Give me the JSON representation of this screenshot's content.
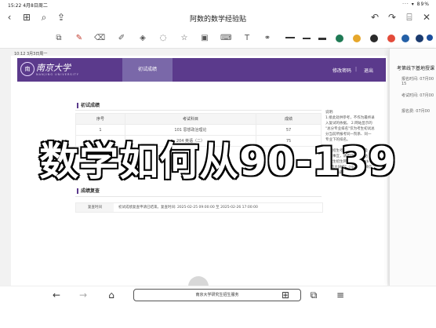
{
  "status_bar": {
    "time_date": "15:22 4月8日周二",
    "indicators": "··· ▾ 89%"
  },
  "top_toolbar": {
    "title": "阿数的数学经验贴",
    "icons": [
      "back-chevron-icon",
      "grid-icon",
      "search-icon",
      "share-icon",
      "undo-icon",
      "redo-icon",
      "bookmark-icon",
      "close-icon"
    ]
  },
  "draw_toolbar": {
    "tools": [
      "lasso-image-icon",
      "pen-icon",
      "eraser-icon",
      "highlighter-icon",
      "shapes-icon",
      "lasso-icon",
      "star-sticker-icon",
      "image-icon",
      "keyboard-icon",
      "text-box-icon",
      "link-icon"
    ],
    "colors": [
      "#1a1a1a",
      "#1f7a55",
      "#e6a72b",
      "#1d4f9c",
      "#e34b3a",
      "#2a2a2a",
      "#2460a7",
      "#1b3b6f"
    ]
  },
  "page_meta": "10:12 3月3日周一",
  "site": {
    "logo_text": "南京大学",
    "logo_sub": "NANJING UNIVERSITY",
    "active_tab": "初试成绩",
    "links": {
      "change_password": "修改密码",
      "logout": "退出"
    }
  },
  "scores": {
    "section_title": "初试成绩",
    "headers": [
      "序号",
      "考试科目",
      "成绩"
    ],
    "rows": [
      [
        "1",
        "101 思想政治理论",
        "57"
      ],
      [
        "2",
        "204 英语（二）",
        "75"
      ]
    ]
  },
  "retest": {
    "section_title": "成绩复查",
    "label": "复查时间",
    "value": "初试成绩复查申请已结束。复查时间: 2025-02-25 09:00:00 至 2025-02-26 17:00:00"
  },
  "notice": {
    "lines": [
      "说明:",
      "1.接此处供参考，不作为最终录",
      "入复试的依据。 2.网站显示的",
      "\"总分专业排名\"仅为考生初试总",
      "分当前所报考同一院系、同一",
      "专业下的排名。",
      "",
      "究生招生考试复试分数线及",
      "复试事宜，请密切关注网站",
      "研究生招生网（https://yzb.nju.edu.cn）",
      "及\"南大研招\"（njuyzb）微信",
      "公众号的最新公告。"
    ]
  },
  "right_panel": {
    "title": "考第线下基地授课",
    "items": [
      "报名时间: 07月00",
      "15",
      "考试时间: 07月00",
      "报名费: 07月00"
    ]
  },
  "overlay_caption": "数学如何从90-139",
  "bottom_bar": {
    "url": "南京大学研究生招生服务"
  }
}
